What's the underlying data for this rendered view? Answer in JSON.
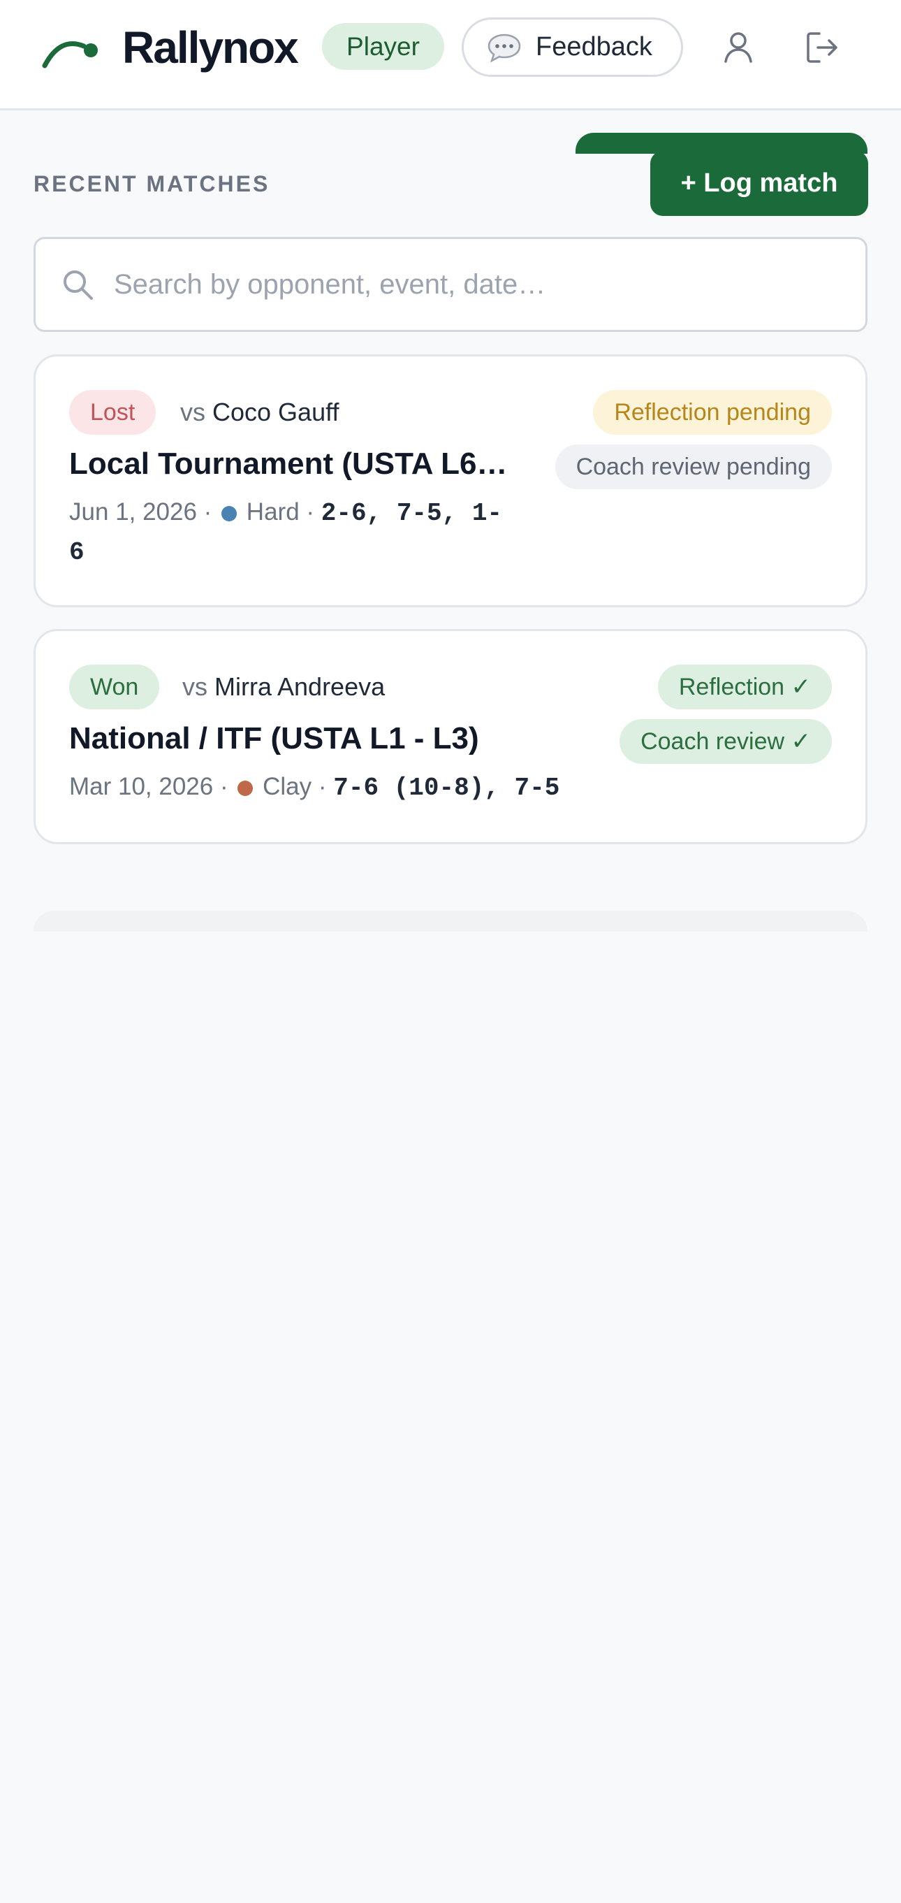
{
  "header": {
    "brand": "Rallynox",
    "role": "Player",
    "feedback_label": "Feedback",
    "icons": [
      "logo-arc-icon",
      "chat-bubble-icon",
      "user-icon",
      "logout-icon"
    ]
  },
  "section": {
    "title": "RECENT MATCHES",
    "log_match_label": "+ Log match"
  },
  "search": {
    "placeholder": "Search by opponent, event, date…",
    "value": ""
  },
  "matches": [
    {
      "result": "Lost",
      "vs_prefix": "vs",
      "opponent": "Coco Gauff",
      "event": "Local Tournament (USTA L6…",
      "date": "Jun 1, 2026",
      "surface": "Hard",
      "surface_color": "#4a82b4",
      "score": "2-6, 7-5, 1-6",
      "reflection_status": "Reflection pending",
      "coach_status": "Coach review pending"
    },
    {
      "result": "Won",
      "vs_prefix": "vs",
      "opponent": "Mirra Andreeva",
      "event": "National / ITF (USTA L1 - L3)",
      "date": "Mar 10, 2026",
      "surface": "Clay",
      "surface_color": "#c0684a",
      "score": "7-6 (10-8), 7-5",
      "reflection_status": "Reflection ✓",
      "coach_status": "Coach review ✓"
    }
  ],
  "colors": {
    "brand_green": "#1b6b3a",
    "background": "#f8f9fb"
  }
}
